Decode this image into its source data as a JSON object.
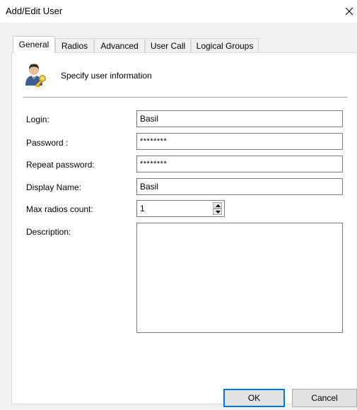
{
  "window": {
    "title": "Add/Edit User"
  },
  "tabs": [
    {
      "label": "General",
      "active": true
    },
    {
      "label": "Radios"
    },
    {
      "label": "Advanced"
    },
    {
      "label": "User Call"
    },
    {
      "label": "Logical Groups"
    }
  ],
  "header": {
    "text": "Specify user information",
    "icon": "user-key-icon"
  },
  "form": {
    "login": {
      "label": "Login:",
      "value": "Basil"
    },
    "password": {
      "label": "Password :",
      "value": "********"
    },
    "repeat_password": {
      "label": "Repeat password:",
      "value": "********"
    },
    "display_name": {
      "label": "Display Name:",
      "value": "Basil"
    },
    "max_radios": {
      "label": "Max radios count:",
      "value": "1"
    },
    "description": {
      "label": "Description:",
      "value": ""
    }
  },
  "buttons": {
    "ok": "OK",
    "cancel": "Cancel"
  },
  "colors": {
    "accent": "#0078d7",
    "dialog_bg": "#f0f0f0"
  }
}
